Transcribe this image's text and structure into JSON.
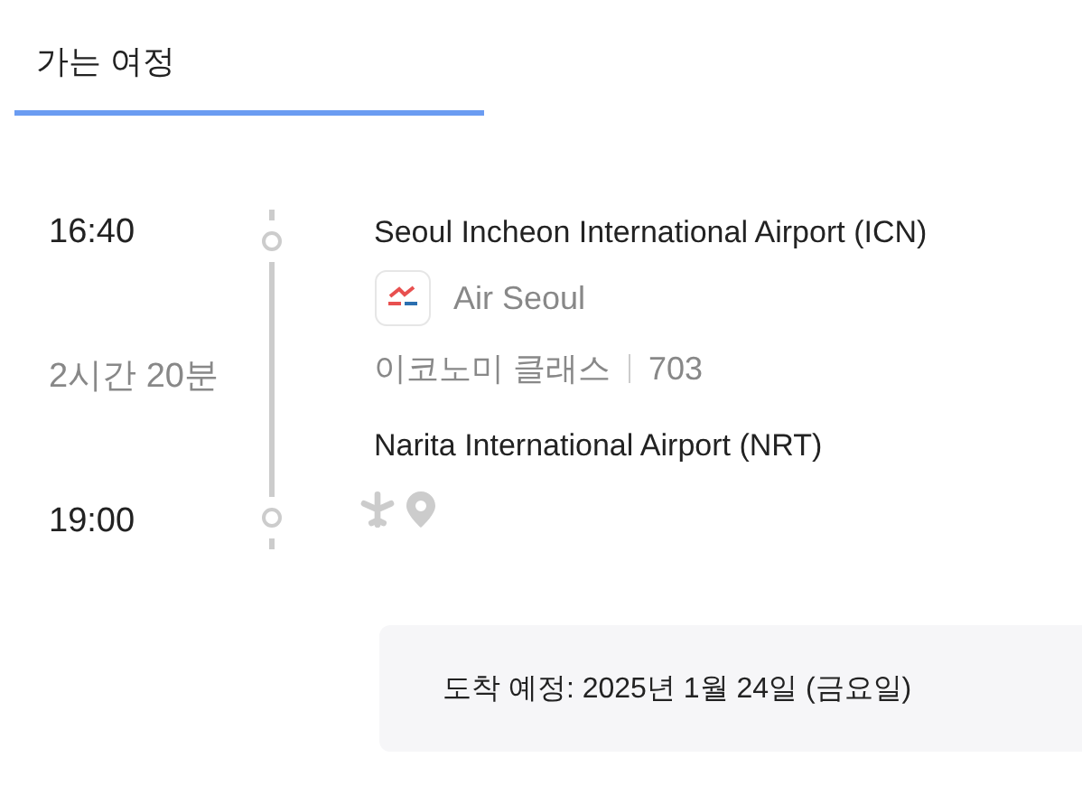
{
  "tabs": [
    {
      "label": "가는 여정",
      "selected": true
    }
  ],
  "itinerary": {
    "departure_time": "16:40",
    "duration": "2시간 20분",
    "arrival_time": "19:00",
    "departure_airport": "Seoul Incheon International Airport (ICN)",
    "airline": "Air Seoul",
    "cabin_class": "이코노미 클래스",
    "flight_number": "703",
    "arrival_airport": "Narita International Airport (NRT)"
  },
  "arrival_note": "도착 예정: 2025년 1월 24일 (금요일)"
}
